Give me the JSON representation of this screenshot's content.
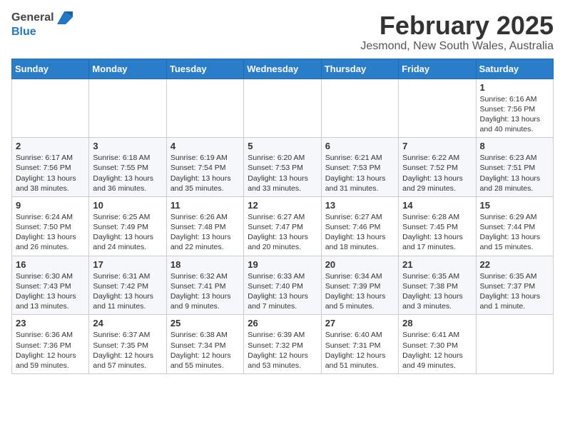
{
  "header": {
    "logo_general": "General",
    "logo_blue": "Blue",
    "month_year": "February 2025",
    "location": "Jesmond, New South Wales, Australia"
  },
  "weekdays": [
    "Sunday",
    "Monday",
    "Tuesday",
    "Wednesday",
    "Thursday",
    "Friday",
    "Saturday"
  ],
  "weeks": [
    [
      {
        "day": "",
        "info": ""
      },
      {
        "day": "",
        "info": ""
      },
      {
        "day": "",
        "info": ""
      },
      {
        "day": "",
        "info": ""
      },
      {
        "day": "",
        "info": ""
      },
      {
        "day": "",
        "info": ""
      },
      {
        "day": "1",
        "info": "Sunrise: 6:16 AM\nSunset: 7:56 PM\nDaylight: 13 hours\nand 40 minutes."
      }
    ],
    [
      {
        "day": "2",
        "info": "Sunrise: 6:17 AM\nSunset: 7:56 PM\nDaylight: 13 hours\nand 38 minutes."
      },
      {
        "day": "3",
        "info": "Sunrise: 6:18 AM\nSunset: 7:55 PM\nDaylight: 13 hours\nand 36 minutes."
      },
      {
        "day": "4",
        "info": "Sunrise: 6:19 AM\nSunset: 7:54 PM\nDaylight: 13 hours\nand 35 minutes."
      },
      {
        "day": "5",
        "info": "Sunrise: 6:20 AM\nSunset: 7:53 PM\nDaylight: 13 hours\nand 33 minutes."
      },
      {
        "day": "6",
        "info": "Sunrise: 6:21 AM\nSunset: 7:53 PM\nDaylight: 13 hours\nand 31 minutes."
      },
      {
        "day": "7",
        "info": "Sunrise: 6:22 AM\nSunset: 7:52 PM\nDaylight: 13 hours\nand 29 minutes."
      },
      {
        "day": "8",
        "info": "Sunrise: 6:23 AM\nSunset: 7:51 PM\nDaylight: 13 hours\nand 28 minutes."
      }
    ],
    [
      {
        "day": "9",
        "info": "Sunrise: 6:24 AM\nSunset: 7:50 PM\nDaylight: 13 hours\nand 26 minutes."
      },
      {
        "day": "10",
        "info": "Sunrise: 6:25 AM\nSunset: 7:49 PM\nDaylight: 13 hours\nand 24 minutes."
      },
      {
        "day": "11",
        "info": "Sunrise: 6:26 AM\nSunset: 7:48 PM\nDaylight: 13 hours\nand 22 minutes."
      },
      {
        "day": "12",
        "info": "Sunrise: 6:27 AM\nSunset: 7:47 PM\nDaylight: 13 hours\nand 20 minutes."
      },
      {
        "day": "13",
        "info": "Sunrise: 6:27 AM\nSunset: 7:46 PM\nDaylight: 13 hours\nand 18 minutes."
      },
      {
        "day": "14",
        "info": "Sunrise: 6:28 AM\nSunset: 7:45 PM\nDaylight: 13 hours\nand 17 minutes."
      },
      {
        "day": "15",
        "info": "Sunrise: 6:29 AM\nSunset: 7:44 PM\nDaylight: 13 hours\nand 15 minutes."
      }
    ],
    [
      {
        "day": "16",
        "info": "Sunrise: 6:30 AM\nSunset: 7:43 PM\nDaylight: 13 hours\nand 13 minutes."
      },
      {
        "day": "17",
        "info": "Sunrise: 6:31 AM\nSunset: 7:42 PM\nDaylight: 13 hours\nand 11 minutes."
      },
      {
        "day": "18",
        "info": "Sunrise: 6:32 AM\nSunset: 7:41 PM\nDaylight: 13 hours\nand 9 minutes."
      },
      {
        "day": "19",
        "info": "Sunrise: 6:33 AM\nSunset: 7:40 PM\nDaylight: 13 hours\nand 7 minutes."
      },
      {
        "day": "20",
        "info": "Sunrise: 6:34 AM\nSunset: 7:39 PM\nDaylight: 13 hours\nand 5 minutes."
      },
      {
        "day": "21",
        "info": "Sunrise: 6:35 AM\nSunset: 7:38 PM\nDaylight: 13 hours\nand 3 minutes."
      },
      {
        "day": "22",
        "info": "Sunrise: 6:35 AM\nSunset: 7:37 PM\nDaylight: 13 hours\nand 1 minute."
      }
    ],
    [
      {
        "day": "23",
        "info": "Sunrise: 6:36 AM\nSunset: 7:36 PM\nDaylight: 12 hours\nand 59 minutes."
      },
      {
        "day": "24",
        "info": "Sunrise: 6:37 AM\nSunset: 7:35 PM\nDaylight: 12 hours\nand 57 minutes."
      },
      {
        "day": "25",
        "info": "Sunrise: 6:38 AM\nSunset: 7:34 PM\nDaylight: 12 hours\nand 55 minutes."
      },
      {
        "day": "26",
        "info": "Sunrise: 6:39 AM\nSunset: 7:32 PM\nDaylight: 12 hours\nand 53 minutes."
      },
      {
        "day": "27",
        "info": "Sunrise: 6:40 AM\nSunset: 7:31 PM\nDaylight: 12 hours\nand 51 minutes."
      },
      {
        "day": "28",
        "info": "Sunrise: 6:41 AM\nSunset: 7:30 PM\nDaylight: 12 hours\nand 49 minutes."
      },
      {
        "day": "",
        "info": ""
      }
    ]
  ]
}
